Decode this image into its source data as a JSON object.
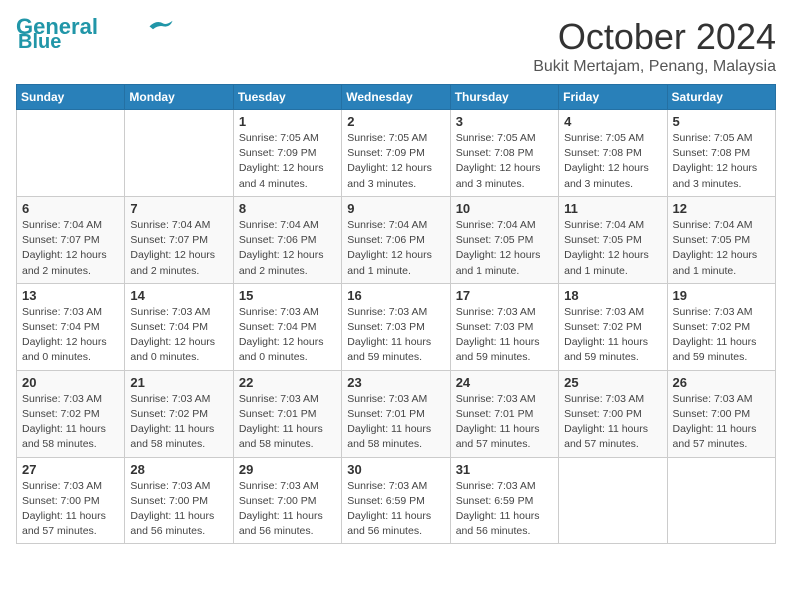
{
  "header": {
    "logo_line1": "General",
    "logo_line2": "Blue",
    "month": "October 2024",
    "location": "Bukit Mertajam, Penang, Malaysia"
  },
  "weekdays": [
    "Sunday",
    "Monday",
    "Tuesday",
    "Wednesday",
    "Thursday",
    "Friday",
    "Saturday"
  ],
  "weeks": [
    [
      {
        "day": "",
        "info": ""
      },
      {
        "day": "",
        "info": ""
      },
      {
        "day": "1",
        "info": "Sunrise: 7:05 AM\nSunset: 7:09 PM\nDaylight: 12 hours and 4 minutes."
      },
      {
        "day": "2",
        "info": "Sunrise: 7:05 AM\nSunset: 7:09 PM\nDaylight: 12 hours and 3 minutes."
      },
      {
        "day": "3",
        "info": "Sunrise: 7:05 AM\nSunset: 7:08 PM\nDaylight: 12 hours and 3 minutes."
      },
      {
        "day": "4",
        "info": "Sunrise: 7:05 AM\nSunset: 7:08 PM\nDaylight: 12 hours and 3 minutes."
      },
      {
        "day": "5",
        "info": "Sunrise: 7:05 AM\nSunset: 7:08 PM\nDaylight: 12 hours and 3 minutes."
      }
    ],
    [
      {
        "day": "6",
        "info": "Sunrise: 7:04 AM\nSunset: 7:07 PM\nDaylight: 12 hours and 2 minutes."
      },
      {
        "day": "7",
        "info": "Sunrise: 7:04 AM\nSunset: 7:07 PM\nDaylight: 12 hours and 2 minutes."
      },
      {
        "day": "8",
        "info": "Sunrise: 7:04 AM\nSunset: 7:06 PM\nDaylight: 12 hours and 2 minutes."
      },
      {
        "day": "9",
        "info": "Sunrise: 7:04 AM\nSunset: 7:06 PM\nDaylight: 12 hours and 1 minute."
      },
      {
        "day": "10",
        "info": "Sunrise: 7:04 AM\nSunset: 7:05 PM\nDaylight: 12 hours and 1 minute."
      },
      {
        "day": "11",
        "info": "Sunrise: 7:04 AM\nSunset: 7:05 PM\nDaylight: 12 hours and 1 minute."
      },
      {
        "day": "12",
        "info": "Sunrise: 7:04 AM\nSunset: 7:05 PM\nDaylight: 12 hours and 1 minute."
      }
    ],
    [
      {
        "day": "13",
        "info": "Sunrise: 7:03 AM\nSunset: 7:04 PM\nDaylight: 12 hours and 0 minutes."
      },
      {
        "day": "14",
        "info": "Sunrise: 7:03 AM\nSunset: 7:04 PM\nDaylight: 12 hours and 0 minutes."
      },
      {
        "day": "15",
        "info": "Sunrise: 7:03 AM\nSunset: 7:04 PM\nDaylight: 12 hours and 0 minutes."
      },
      {
        "day": "16",
        "info": "Sunrise: 7:03 AM\nSunset: 7:03 PM\nDaylight: 11 hours and 59 minutes."
      },
      {
        "day": "17",
        "info": "Sunrise: 7:03 AM\nSunset: 7:03 PM\nDaylight: 11 hours and 59 minutes."
      },
      {
        "day": "18",
        "info": "Sunrise: 7:03 AM\nSunset: 7:02 PM\nDaylight: 11 hours and 59 minutes."
      },
      {
        "day": "19",
        "info": "Sunrise: 7:03 AM\nSunset: 7:02 PM\nDaylight: 11 hours and 59 minutes."
      }
    ],
    [
      {
        "day": "20",
        "info": "Sunrise: 7:03 AM\nSunset: 7:02 PM\nDaylight: 11 hours and 58 minutes."
      },
      {
        "day": "21",
        "info": "Sunrise: 7:03 AM\nSunset: 7:02 PM\nDaylight: 11 hours and 58 minutes."
      },
      {
        "day": "22",
        "info": "Sunrise: 7:03 AM\nSunset: 7:01 PM\nDaylight: 11 hours and 58 minutes."
      },
      {
        "day": "23",
        "info": "Sunrise: 7:03 AM\nSunset: 7:01 PM\nDaylight: 11 hours and 58 minutes."
      },
      {
        "day": "24",
        "info": "Sunrise: 7:03 AM\nSunset: 7:01 PM\nDaylight: 11 hours and 57 minutes."
      },
      {
        "day": "25",
        "info": "Sunrise: 7:03 AM\nSunset: 7:00 PM\nDaylight: 11 hours and 57 minutes."
      },
      {
        "day": "26",
        "info": "Sunrise: 7:03 AM\nSunset: 7:00 PM\nDaylight: 11 hours and 57 minutes."
      }
    ],
    [
      {
        "day": "27",
        "info": "Sunrise: 7:03 AM\nSunset: 7:00 PM\nDaylight: 11 hours and 57 minutes."
      },
      {
        "day": "28",
        "info": "Sunrise: 7:03 AM\nSunset: 7:00 PM\nDaylight: 11 hours and 56 minutes."
      },
      {
        "day": "29",
        "info": "Sunrise: 7:03 AM\nSunset: 7:00 PM\nDaylight: 11 hours and 56 minutes."
      },
      {
        "day": "30",
        "info": "Sunrise: 7:03 AM\nSunset: 6:59 PM\nDaylight: 11 hours and 56 minutes."
      },
      {
        "day": "31",
        "info": "Sunrise: 7:03 AM\nSunset: 6:59 PM\nDaylight: 11 hours and 56 minutes."
      },
      {
        "day": "",
        "info": ""
      },
      {
        "day": "",
        "info": ""
      }
    ]
  ]
}
